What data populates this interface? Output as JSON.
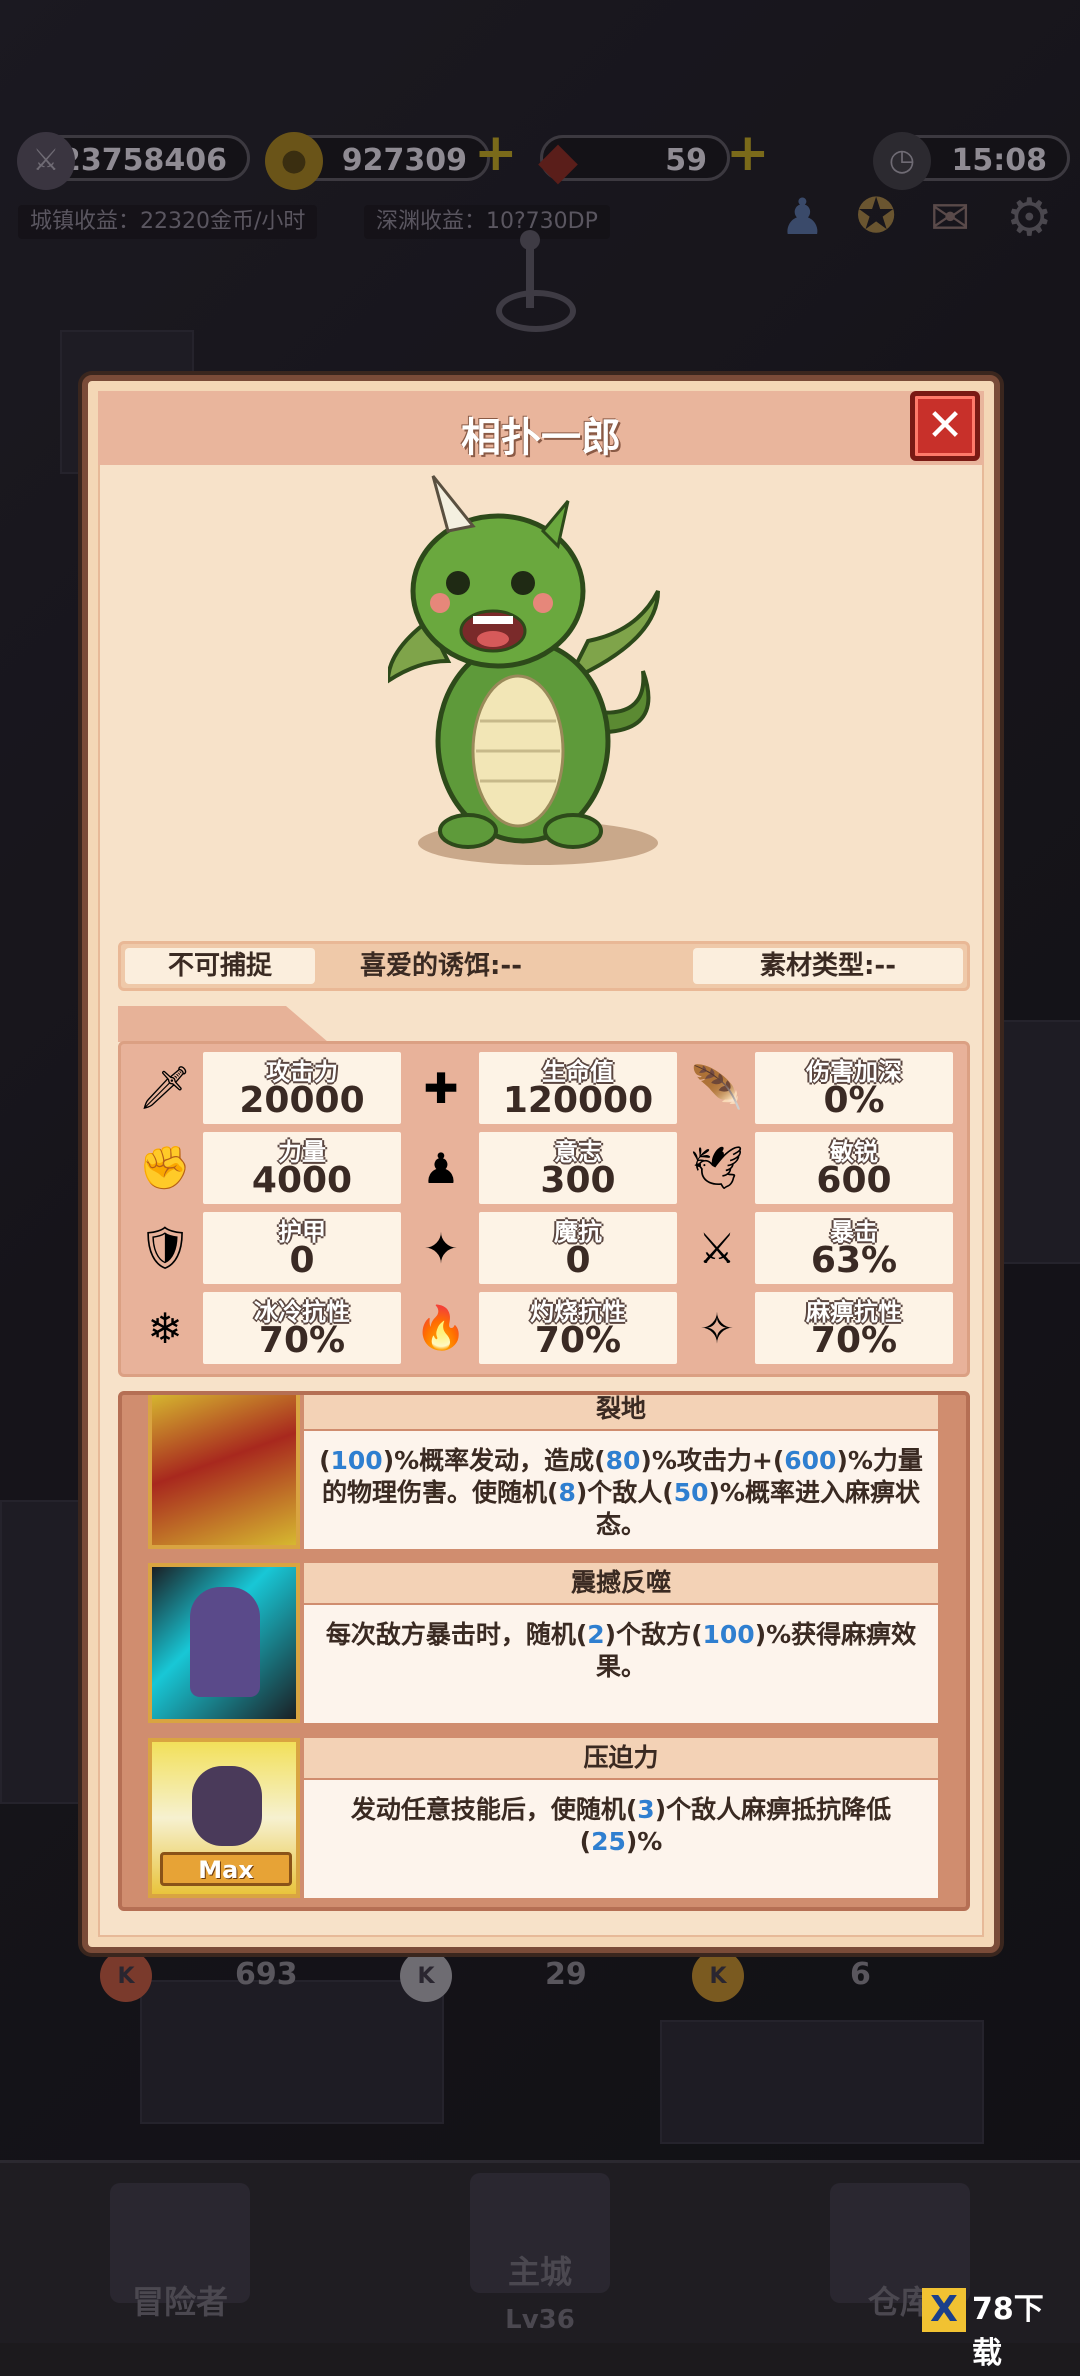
{
  "resources": {
    "power": "23758406",
    "gold": "927309",
    "gems": "59",
    "time": "15:08"
  },
  "income": {
    "town": "城镇收益：22320金币/小时",
    "abyss": "深渊收益：10?730DP"
  },
  "modal": {
    "title": "相扑一郎",
    "close_icon": "close-x-icon"
  },
  "info": {
    "capture": "不可捕捉",
    "bait": "喜爱的诱饵:--",
    "material": "素材类型:--"
  },
  "stats": [
    {
      "icon": "sword-icon",
      "glyph": "🗡",
      "label": "攻击力",
      "value": "20000"
    },
    {
      "icon": "health-cross-icon",
      "glyph": "✚",
      "label": "生命值",
      "value": "120000"
    },
    {
      "icon": "feather-icon",
      "glyph": "🪶",
      "label": "伤害加深",
      "value": "0%"
    },
    {
      "icon": "fist-icon",
      "glyph": "✊",
      "label": "力量",
      "value": "4000"
    },
    {
      "icon": "will-statue-icon",
      "glyph": "♟",
      "label": "意志",
      "value": "300"
    },
    {
      "icon": "wing-icon",
      "glyph": "🕊",
      "label": "敏锐",
      "value": "600"
    },
    {
      "icon": "shield-icon",
      "glyph": "🛡",
      "label": "护甲",
      "value": "0"
    },
    {
      "icon": "magic-resist-icon",
      "glyph": "✦",
      "label": "魔抗",
      "value": "0"
    },
    {
      "icon": "crossed-swords-icon",
      "glyph": "⚔",
      "label": "暴击",
      "value": "63%"
    },
    {
      "icon": "ice-icon",
      "glyph": "❄",
      "label": "冰冷抗性",
      "value": "70%"
    },
    {
      "icon": "fire-icon",
      "glyph": "🔥",
      "label": "灼烧抗性",
      "value": "70%"
    },
    {
      "icon": "paralysis-icon",
      "glyph": "✧",
      "label": "麻痹抗性",
      "value": "70%"
    }
  ],
  "skills": [
    {
      "name": "裂地",
      "desc_parts": [
        "(",
        "100",
        ")%概率发动，造成(",
        "80",
        ")%攻击力+(",
        "600",
        ")%力量的物理伤害。使随机(",
        "8",
        ")个敌人(",
        "50",
        ")%概率进入麻痹状态。"
      ]
    },
    {
      "name": "震撼反噬",
      "desc_parts": [
        "每次敌方暴击时，随机(",
        "2",
        ")个敌方(",
        "100",
        ")%获得麻痹效果。"
      ]
    },
    {
      "name": "压迫力",
      "desc_parts": [
        "发动任意技能后，使随机(",
        "3",
        ")个敌人麻痹抵抗降低(",
        "25",
        ")%"
      ],
      "badge": "Max"
    }
  ],
  "bottom_counts": [
    "693",
    "29",
    "6"
  ],
  "nav": {
    "adventurer": "冒险者",
    "main_city": "主城",
    "main_city_level": "Lv36",
    "warehouse": "仓库"
  },
  "watermark": "78下载",
  "colors": {
    "accent": "#e9b59c",
    "close": "#c8302a",
    "highlight_number": "#2f7fd0"
  }
}
